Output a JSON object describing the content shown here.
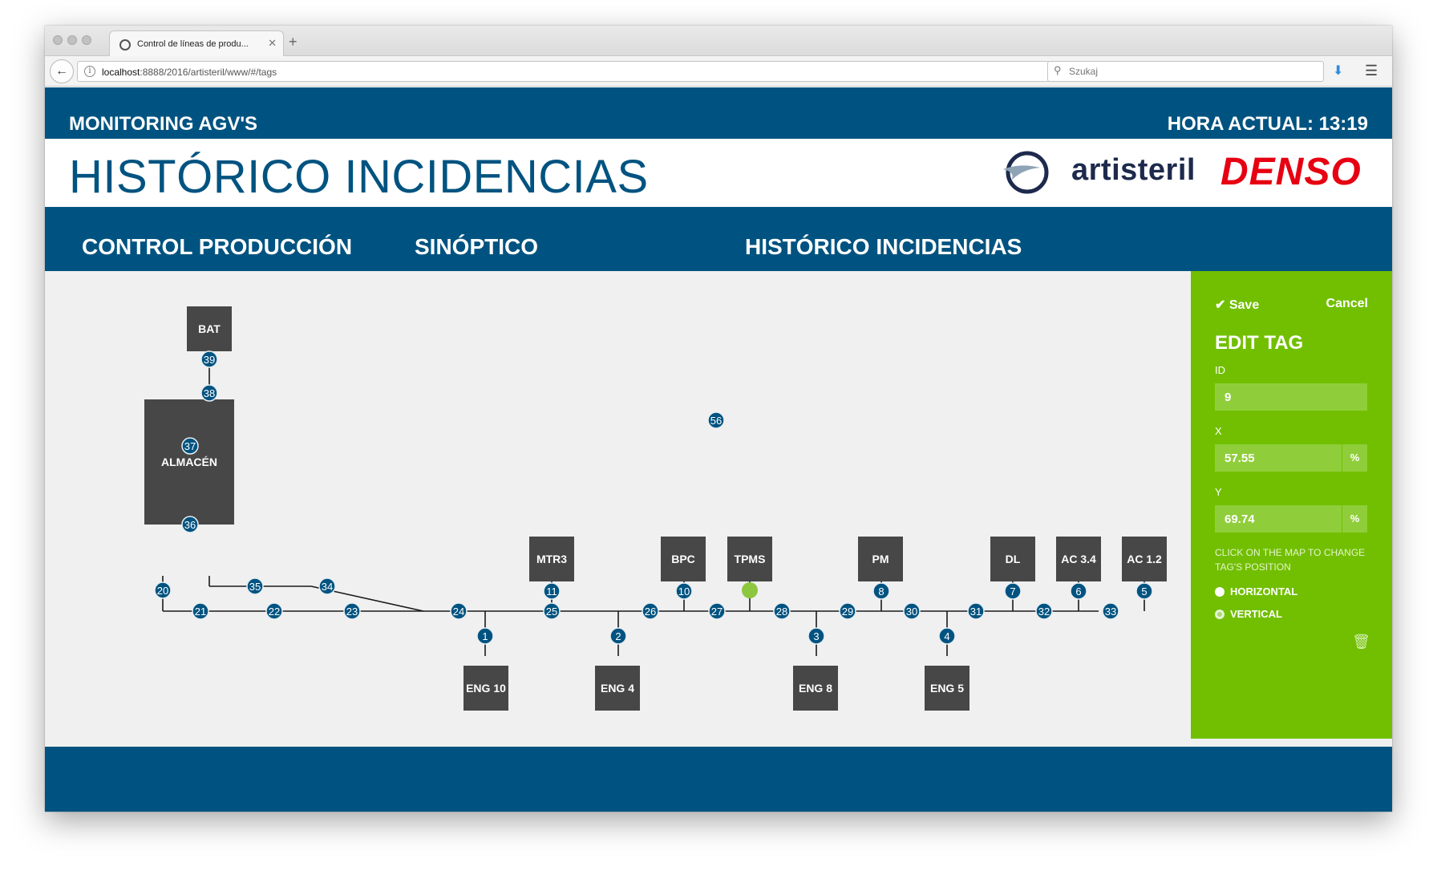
{
  "browser": {
    "tab_title": "Control de líneas de produ...",
    "url_host": "localhost",
    "url_rest": ":8888/2016/artisteril/www/#/tags",
    "search_placeholder": "Szukaj"
  },
  "header": {
    "brand": "MONITORING AGV'S",
    "clock": "HORA ACTUAL: 13:19",
    "page_title": "HISTÓRICO INCIDENCIAS",
    "logo_text": "artisteril",
    "partner_logo": "DENSO"
  },
  "menu": [
    {
      "label": "CONTROL PRODUCCIÓN"
    },
    {
      "label": "SINÓPTICO"
    },
    {
      "label": "HISTÓRICO INCIDENCIAS"
    }
  ],
  "panel": {
    "save_label": "Save",
    "cancel_label": "Cancel",
    "heading": "EDIT TAG",
    "id_label": "ID",
    "id_value": "9",
    "x_label": "X",
    "x_value": "57.55",
    "x_unit": "%",
    "y_label": "Y",
    "y_value": "69.74",
    "y_unit": "%",
    "hint": "CLICK ON THE MAP TO CHANGE TAG'S POSITION",
    "orientation_options": [
      "HORIZONTAL",
      "VERTICAL"
    ],
    "orientation_selected": "VERTICAL"
  },
  "map": {
    "stations": [
      {
        "id": "bat",
        "label": "BAT"
      },
      {
        "id": "almacen",
        "label": "ALMACÉN"
      },
      {
        "id": "mtr3",
        "label": "MTR3"
      },
      {
        "id": "bpc",
        "label": "BPC"
      },
      {
        "id": "tpms",
        "label": "TPMS"
      },
      {
        "id": "pm",
        "label": "PM"
      },
      {
        "id": "dl",
        "label": "DL"
      },
      {
        "id": "ac34",
        "label": "AC 3.4"
      },
      {
        "id": "ac12",
        "label": "AC 1.2"
      },
      {
        "id": "eng10",
        "label": "ENG 10"
      },
      {
        "id": "eng4",
        "label": "ENG 4"
      },
      {
        "id": "eng8",
        "label": "ENG 8"
      },
      {
        "id": "eng5",
        "label": "ENG 5"
      }
    ],
    "tags": [
      "1",
      "2",
      "3",
      "4",
      "5",
      "6",
      "7",
      "8",
      "10",
      "11",
      "20",
      "21",
      "22",
      "23",
      "24",
      "25",
      "26",
      "27",
      "28",
      "29",
      "30",
      "31",
      "32",
      "33",
      "34",
      "35",
      "36",
      "37",
      "38",
      "39",
      "56"
    ],
    "selected_tag": "9"
  },
  "colors": {
    "primary": "#005380",
    "panel": "#71bf00",
    "station": "#474747",
    "tag": "#005380",
    "selected_tag": "#8dc63f",
    "denso": "#e60012"
  }
}
